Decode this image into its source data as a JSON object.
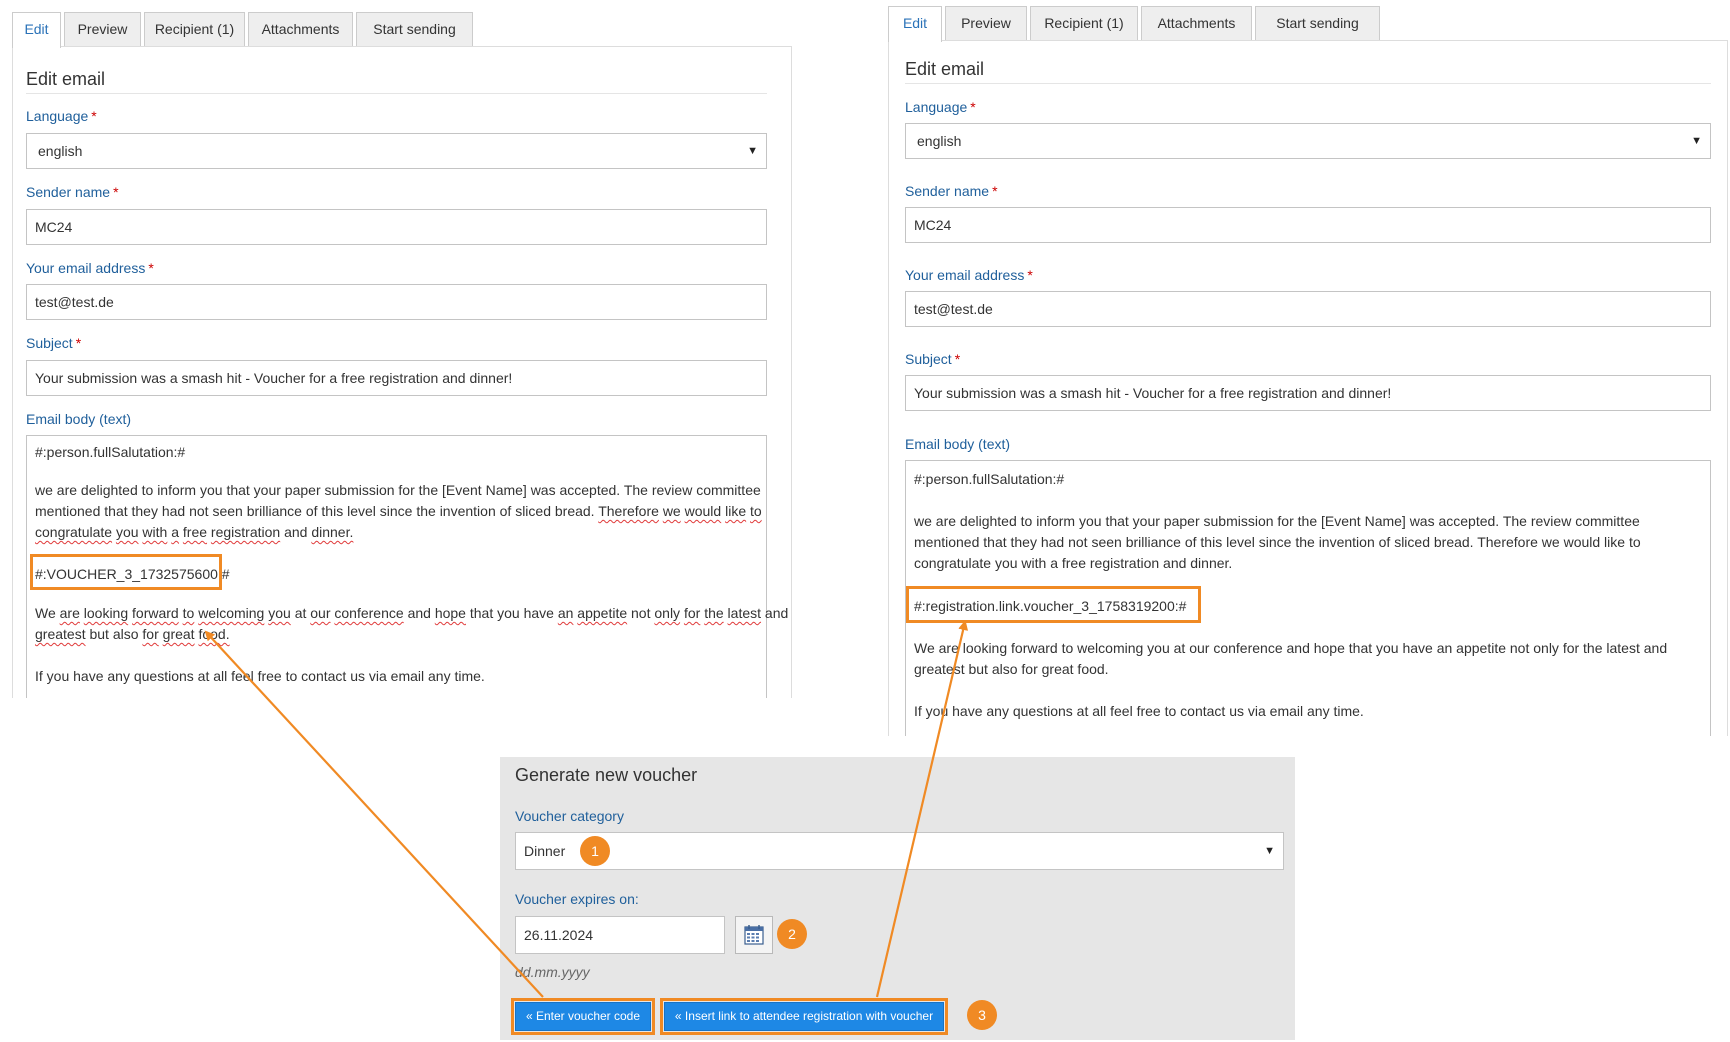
{
  "tabs": [
    "Edit",
    "Preview",
    "Recipient (1)",
    "Attachments",
    "Start sending"
  ],
  "form": {
    "title": "Edit email",
    "language_label": "Language",
    "language_value": "english",
    "sender_label": "Sender name",
    "sender_value": "MC24",
    "email_label": "Your email address",
    "email_value": "test@test.de",
    "subject_label": "Subject",
    "subject_value": "Your submission was a smash hit - Voucher for a free registration and dinner!",
    "body_label": "Email body (text)",
    "required_mark": "*"
  },
  "left_body": {
    "salutation": "#:person.fullSalutation:#",
    "p1_l1": "we are delighted to inform you that your paper submission for the [Event Name] was accepted. The review committee",
    "p1_l2_a": "mentioned that they had not seen brilliance of this level since the invention of sliced bread.",
    "p1_l2_b": "Therefore",
    "p1_l2_c": "we",
    "p1_l2_d": "would",
    "p1_l2_e": "like",
    "p1_l2_f": "to",
    "p1_l3_a": "congratulate",
    "p1_l3_b": "you",
    "p1_l3_c": "with",
    "p1_l3_d": "a",
    "p1_l3_e": "free",
    "p1_l3_f": "registration",
    "p1_l3_g": "and",
    "p1_l3_h": "dinner.",
    "placeholder": "#:VOUCHER_3_1732575600:#",
    "p2_l1_a": "We",
    "p2_l1_b": "are",
    "p2_l1_c": "looking",
    "p2_l1_d": "forward",
    "p2_l1_e": "to",
    "p2_l1_f": "welcoming",
    "p2_l1_g": "you",
    "p2_l1_h": "at",
    "p2_l1_i": "our",
    "p2_l1_j": "conference",
    "p2_l1_k": "and",
    "p2_l1_l": "hope",
    "p2_l1_m": "that",
    "p2_l1_n": "you",
    "p2_l1_o": "have",
    "p2_l1_p": "an",
    "p2_l1_q": "appetite",
    "p2_l1_r": "not",
    "p2_l1_s": "only",
    "p2_l1_t": "for",
    "p2_l1_u": "the",
    "p2_l1_v": "latest",
    "p2_l1_w": "and",
    "p2_l2_a": "greatest",
    "p2_l2_b": "but",
    "p2_l2_c": "also",
    "p2_l2_d": "for",
    "p2_l2_e": "great",
    "p2_l2_f": "food.",
    "p3": "If you have any questions at all feel free to contact us via email any time."
  },
  "right_body": {
    "salutation": "#:person.fullSalutation:#",
    "p1_l1": "we are delighted to inform you that your paper submission for the [Event Name] was accepted. The review committee",
    "p1_l2": "mentioned that they had not seen brilliance of this level since the invention of sliced bread. Therefore we would like to",
    "p1_l3": "congratulate you with a free registration and dinner.",
    "placeholder": "#:registration.link.voucher_3_1758319200:#",
    "p2_l1": "We are looking forward to welcoming you at our conference and hope that you have an appetite not only for the latest and",
    "p2_l2": "greatest but also for great food.",
    "p3": "If you have any questions at all feel free to contact us via email any time."
  },
  "voucher": {
    "title": "Generate new voucher",
    "category_label": "Voucher category",
    "category_value": "Dinner",
    "expires_label": "Voucher expires on:",
    "expires_value": "26.11.2024",
    "date_hint": "dd.mm.yyyy",
    "enter_code_button": "« Enter voucher code",
    "insert_link_button": "« Insert link to attendee registration with voucher"
  },
  "badges": [
    "1",
    "2",
    "3"
  ],
  "colors": {
    "accent_orange": "#f08a24",
    "button_blue": "#1e88e5",
    "label_blue": "#1f5f9b",
    "tab_active_text": "#2a72b8",
    "required_red": "#cc0000",
    "spell_underline": "#e03a3a",
    "voucher_bg": "#e6e6e6"
  },
  "icons": {
    "select_caret": "caret-down-icon",
    "calendar": "calendar-icon"
  }
}
